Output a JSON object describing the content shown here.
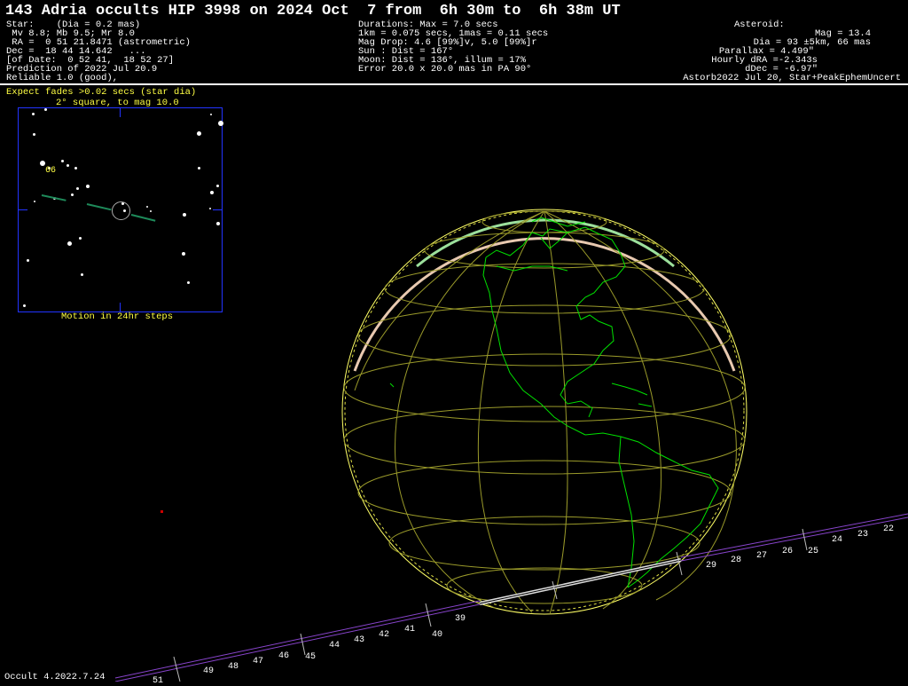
{
  "header": {
    "title": "143 Adria occults HIP 3998 on 2024 Oct  7 from  6h 30m to  6h 38m UT",
    "star_lines": [
      "Star:    (Dia = 0.2 mas)",
      " Mv 8.8; Mb 9.5; Mr 8.0",
      " RA =  0 51 21.8471 (astrometric)",
      "Dec =  18 44 14.642   ...",
      "[of Date:  0 52 41,  18 52 27]",
      "Prediction of 2022 Jul 20.9",
      "Reliable 1.0 (good),"
    ],
    "event_lines": [
      "Durations: Max = 7.0 secs",
      "1km = 0.075 secs, 1mas = 0.11 secs",
      "Mag Drop: 4.6 [99%]v, 5.0 [99%]r",
      "Sun : Dist = 167°",
      "Moon: Dist = 136°, illum = 17%",
      "Error 20.0 x 20.0 mas in PA 90°"
    ],
    "asteroid_lines": [
      "Asteroid:",
      "Mag = 13.4",
      "Dia = 93 ±5km, 66 mas",
      "Parallax = 4.499\"",
      "Hourly dRA =-2.343s",
      "dDec = -6.97\"",
      "Astorb2022 Jul 20, Star+PeakEphemUncert"
    ]
  },
  "inset": {
    "fade_note": "Expect fades >0.02 secs (star dia)",
    "caption_top": "2° square, to mag 10.0",
    "caption_bottom": "Motion in 24hr steps",
    "star_label": "66"
  },
  "track_labels": [
    "22",
    "23",
    "24",
    "25",
    "26",
    "27",
    "28",
    "29",
    "39",
    "40",
    "41",
    "42",
    "43",
    "44",
    "45",
    "46",
    "47",
    "48",
    "49",
    "51"
  ],
  "footer": {
    "version": "Occult 4.2022.7.24"
  },
  "colors": {
    "coast": "#00e000",
    "grid": "#9a9a2a",
    "inset_border": "#2233ff",
    "path_line": "#dddddd",
    "track": "#8844cc",
    "yellow_text": "#ffff44"
  }
}
